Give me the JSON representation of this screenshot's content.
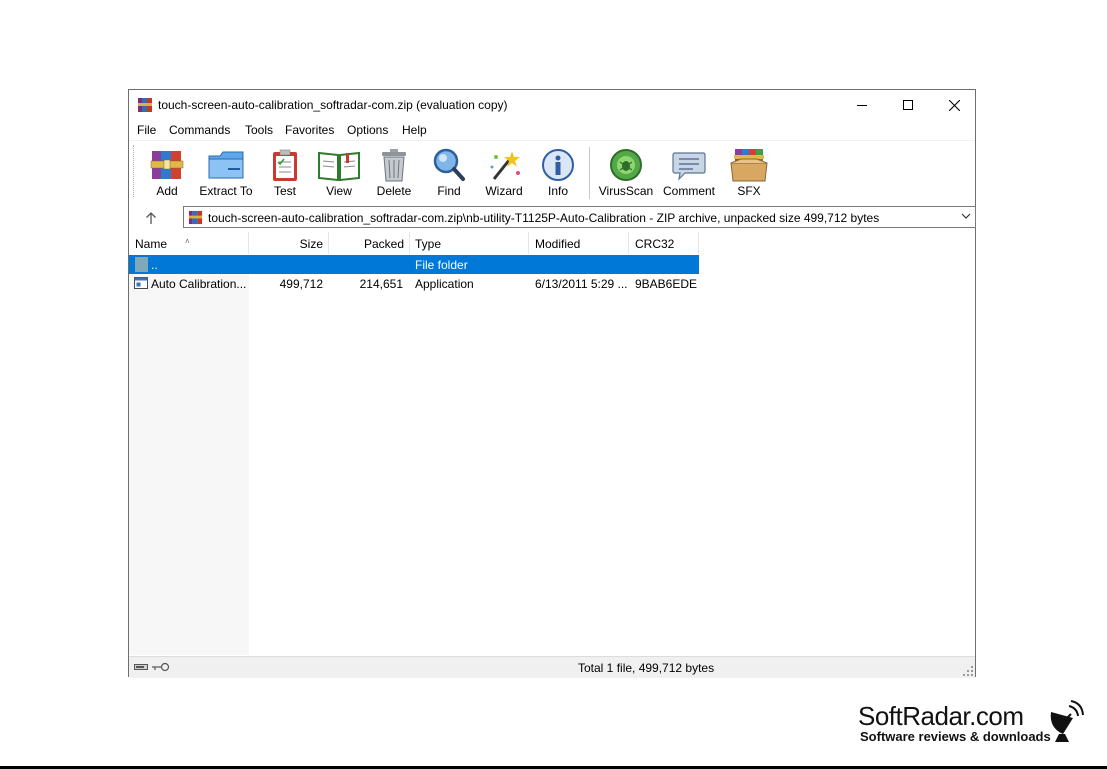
{
  "window": {
    "title": "touch-screen-auto-calibration_softradar-com.zip (evaluation copy)"
  },
  "menu": [
    "File",
    "Commands",
    "Tools",
    "Favorites",
    "Options",
    "Help"
  ],
  "toolbar": [
    {
      "label": "Add",
      "icon": "add-archive-icon"
    },
    {
      "label": "Extract To",
      "icon": "extract-folder-icon"
    },
    {
      "label": "Test",
      "icon": "test-clipboard-icon"
    },
    {
      "label": "View",
      "icon": "view-book-icon"
    },
    {
      "label": "Delete",
      "icon": "trash-icon"
    },
    {
      "label": "Find",
      "icon": "magnifier-icon"
    },
    {
      "label": "Wizard",
      "icon": "wand-icon"
    },
    {
      "label": "Info",
      "icon": "info-icon"
    },
    {
      "label": "VirusScan",
      "icon": "virus-scan-icon"
    },
    {
      "label": "Comment",
      "icon": "comment-icon"
    },
    {
      "label": "SFX",
      "icon": "sfx-box-icon"
    }
  ],
  "address": {
    "path": "touch-screen-auto-calibration_softradar-com.zip\\nb-utility-T1125P-Auto-Calibration - ZIP archive, unpacked size 499,712 bytes"
  },
  "columns": {
    "name": "Name",
    "size": "Size",
    "packed": "Packed",
    "type": "Type",
    "modified": "Modified",
    "crc": "CRC32"
  },
  "rows": [
    {
      "name": "..",
      "size": "",
      "packed": "",
      "type": "File folder",
      "modified": "",
      "crc": ""
    },
    {
      "name": "Auto Calibration...",
      "size": "499,712",
      "packed": "214,651",
      "type": "Application",
      "modified": "6/13/2011 5:29 ...",
      "crc": "9BAB6EDE"
    }
  ],
  "status": {
    "text": "Total 1 file, 499,712 bytes"
  },
  "watermark": {
    "brand": "SoftRadar.com",
    "tagline": "Software reviews & downloads"
  },
  "colors": {
    "selection": "#0078d7",
    "border": "#6e6e6e"
  }
}
